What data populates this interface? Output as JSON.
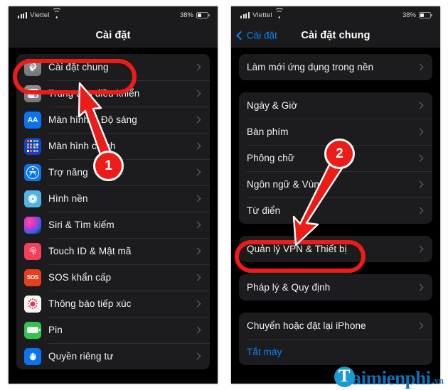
{
  "status_bar": {
    "carrier": "Viettel",
    "battery_percent": "38%",
    "signal_icon": "cellular-bars-icon",
    "wifi_icon": "wifi-icon",
    "battery_icon": "battery-icon"
  },
  "colors": {
    "accent_blue": "#0a84ff",
    "annotation_red": "#ee1c18",
    "group_bg": "#1c1c1e",
    "screen_bg": "#000000",
    "navbar_bg": "#1b1b1d",
    "watermark_blue": "#0b73b8"
  },
  "left_phone": {
    "nav": {
      "title": "Cài đặt"
    },
    "groups": [
      {
        "rows": [
          {
            "label": "Cài đặt chung",
            "icon": "gear-icon",
            "icon_style": "ic-gray",
            "highlighted": true
          },
          {
            "label": "Trung tâm điều khiển",
            "icon": "control-center-icon",
            "icon_style": "ic-gray"
          },
          {
            "label": "Màn hình & Độ sáng",
            "icon": "display-brightness-icon",
            "icon_style": "ic-blue"
          },
          {
            "label": "Màn hình chính",
            "icon": "home-screen-icon",
            "icon_style": "ic-grid"
          },
          {
            "label": "Trợ năng",
            "icon": "accessibility-icon",
            "icon_style": "ic-blue"
          },
          {
            "label": "Hình nền",
            "icon": "wallpaper-icon",
            "icon_style": "ic-ltblue"
          },
          {
            "label": "Siri & Tìm kiếm",
            "icon": "siri-icon",
            "icon_style": "ic-siri"
          },
          {
            "label": "Touch ID & Mật mã",
            "icon": "touch-id-icon",
            "icon_style": "ic-pink"
          },
          {
            "label": "SOS khẩn cấp",
            "icon": "sos-icon",
            "icon_style": "ic-red"
          },
          {
            "label": "Thông báo tiếp xúc",
            "icon": "exposure-notification-icon",
            "icon_style": "ic-white"
          },
          {
            "label": "Pin",
            "icon": "battery-settings-icon",
            "icon_style": "ic-green"
          },
          {
            "label": "Quyền riêng tư",
            "icon": "privacy-hand-icon",
            "icon_style": "ic-blue"
          }
        ]
      }
    ]
  },
  "right_phone": {
    "nav": {
      "back_label": "Cài đặt",
      "title": "Cài đặt chung",
      "back_icon": "chevron-left-icon"
    },
    "groups": [
      {
        "rows": [
          {
            "label": "Làm mới ứng dụng trong nền"
          }
        ]
      },
      {
        "rows": [
          {
            "label": "Ngày & Giờ"
          },
          {
            "label": "Bàn phím"
          },
          {
            "label": "Phông chữ"
          },
          {
            "label": "Ngôn ngữ & Vùng"
          },
          {
            "label": "Từ điển"
          }
        ]
      },
      {
        "rows": [
          {
            "label": "Quản lý VPN & Thiết bị",
            "highlighted": true
          }
        ]
      },
      {
        "rows": [
          {
            "label": "Pháp lý & Quy định"
          }
        ]
      },
      {
        "rows": [
          {
            "label": "Chuyển hoặc đặt lại iPhone"
          },
          {
            "label": "Tắt máy",
            "link": true
          }
        ]
      }
    ]
  },
  "annotations": {
    "step_1": {
      "number": "1",
      "target": "Cài đặt chung"
    },
    "step_2": {
      "number": "2",
      "target": "Quản lý VPN & Thiết bị"
    }
  },
  "watermark": {
    "logo_letter": "T",
    "name": "aimienphi",
    "tld": ".vn"
  }
}
